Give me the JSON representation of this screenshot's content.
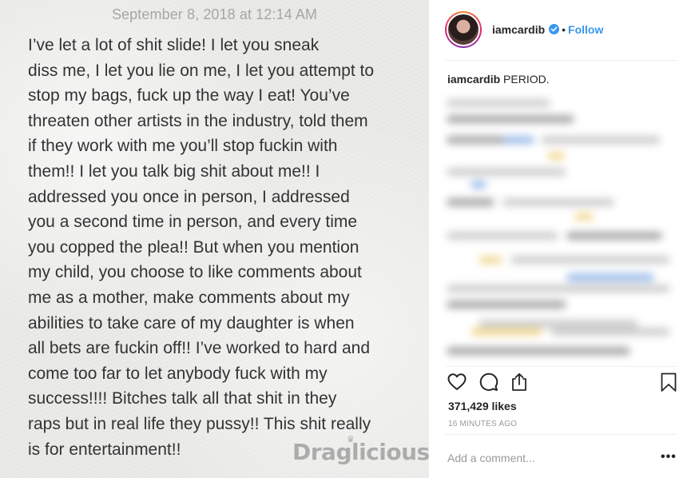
{
  "post_image": {
    "date": "September 8, 2018 at 12:14 AM",
    "lines": [
      "I’ve let a lot of shit slide! I let you sneak",
      "diss me, I let you lie on me, I let you attempt to",
      "stop my bags, fuck up the way I eat! You’ve",
      "threaten other artists in the industry, told them",
      "if they work with me you’ll stop fuckin with",
      "them!! I let you talk big shit about me!! I",
      "addressed you once in person, I addressed",
      "you a second time in person, and every time",
      "you copped the plea!! But when you mention",
      "my child, you choose to like comments about",
      "me as a mother, make comments about my",
      "abilities to take care of my daughter is when",
      "all bets are fuckin off!! I’ve worked to hard and",
      "come too far to let anybody fuck with my",
      "success!!!! Bitches talk all that shit in they",
      "raps but in real life they pussy!! This shit really",
      "is for entertainment!!"
    ],
    "watermark": "Draglicious"
  },
  "header": {
    "username": "iamcardib",
    "separator": "•",
    "follow_label": "Follow",
    "avatar_icon": "profile-avatar",
    "verified_icon": "verified-badge-icon"
  },
  "caption": {
    "username": "iamcardib",
    "text": "PERIOD."
  },
  "actions": {
    "like_icon": "heart-icon",
    "comment_icon": "comment-icon",
    "share_icon": "share-icon",
    "save_icon": "bookmark-icon"
  },
  "likes": "371,429 likes",
  "time_ago": "16 MINUTES AGO",
  "comment_box": {
    "placeholder": "Add a comment...",
    "more_label": "•••"
  },
  "colors": {
    "accent": "#3897f0",
    "text": "#262626",
    "muted": "#999999",
    "note_text": "#333333",
    "note_date": "#a6a6a6"
  }
}
